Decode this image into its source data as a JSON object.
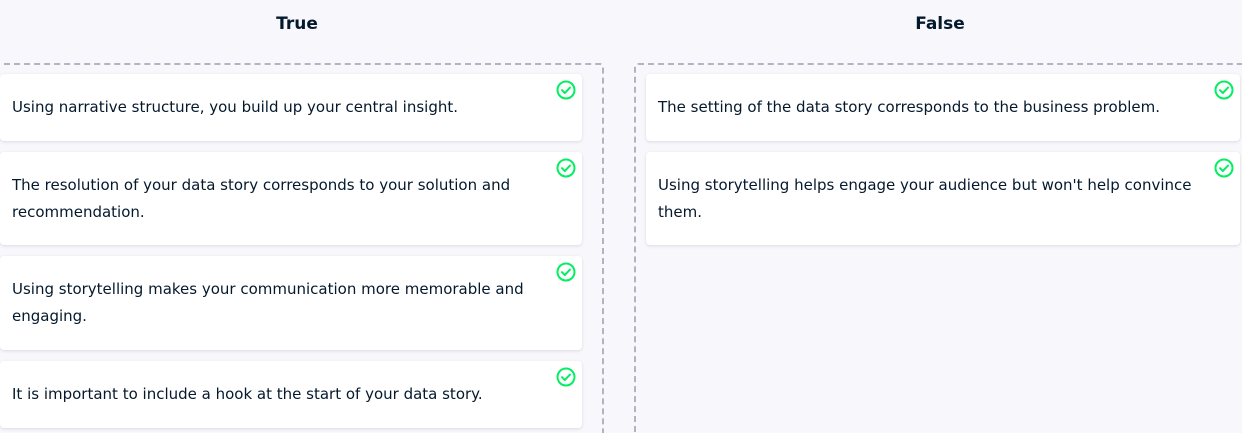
{
  "columns": {
    "true": {
      "title": "True",
      "cards": [
        "Using narrative structure, you build up your central insight.",
        "The resolution of your data story corresponds to your solution and recommendation.",
        "Using storytelling makes your communication more memorable and engaging.",
        "It is important to include a hook at the start of your data story."
      ]
    },
    "false": {
      "title": "False",
      "cards": [
        "The setting of the data story corresponds to the business problem.",
        "Using storytelling helps engage your audience but won't help convince them."
      ]
    }
  },
  "icons": {
    "card_status": "check-circle-icon"
  },
  "colors": {
    "check": "#03ef62",
    "text": "#05192d",
    "background": "#f7f7fc",
    "dropzone_border": "#b1b4c2"
  }
}
